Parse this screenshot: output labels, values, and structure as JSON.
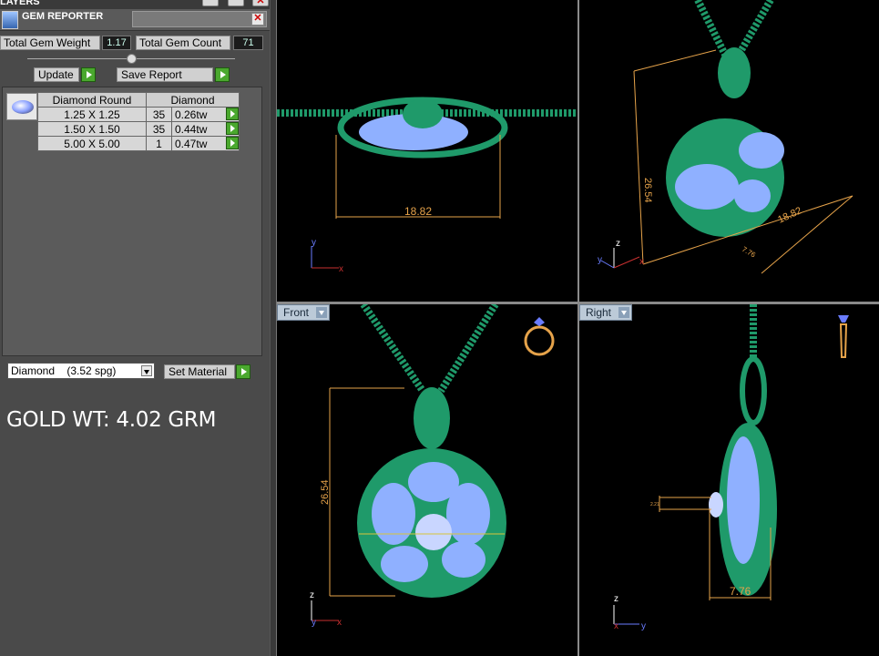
{
  "layers": {
    "title": "LAYERS"
  },
  "gem_reporter": {
    "title": "GEM REPORTER",
    "total_weight_label": "Total Gem Weight",
    "total_weight_value": "1.17",
    "total_count_label": "Total Gem Count",
    "total_count_value": "71",
    "update_label": "Update",
    "save_report_label": "Save Report",
    "table": {
      "headers": [
        "Diamond Round",
        "Diamond"
      ],
      "rows": [
        {
          "size": "1.25 X 1.25",
          "count": "35",
          "weight": "0.26tw"
        },
        {
          "size": "1.50 X 1.50",
          "count": "35",
          "weight": "0.44tw"
        },
        {
          "size": "5.00 X 5.00",
          "count": "1",
          "weight": "0.47tw"
        }
      ]
    },
    "material_select": "Diamond    (3.52 spg)",
    "set_material_label": "Set Material"
  },
  "gold_weight": "GOLD WT: 4.02 GRM",
  "viewports": {
    "top": {
      "dimension": "18.82",
      "axis_y": "y",
      "axis_x": "x"
    },
    "perspective": {
      "height_dim": "26.54",
      "width_dim": "18.82",
      "depth_dim": "7.76",
      "axis_z": "z",
      "axis_y": "y",
      "axis_x": "x"
    },
    "front": {
      "label": "Front",
      "height_dim": "26.54",
      "axis_z": "z",
      "axis_y": "y",
      "axis_x": "x"
    },
    "right": {
      "label": "Right",
      "depth_dim": "7.76",
      "small_dim": "2.21",
      "axis_z": "z",
      "axis_x": "x",
      "axis_y": "y"
    }
  },
  "colors": {
    "metal": "#1f9a6a",
    "gem": "#8fb0ff",
    "dimension": "#e6a34a",
    "panel": "#4a4a4a"
  }
}
